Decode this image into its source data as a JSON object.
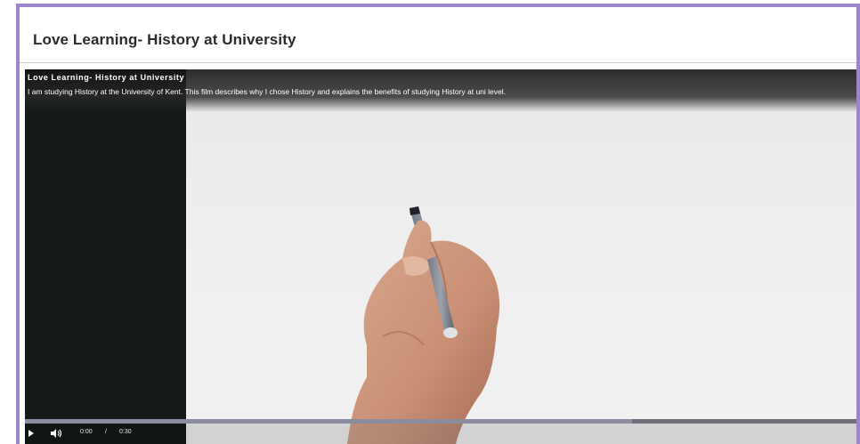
{
  "page": {
    "title": "Love Learning- History at University"
  },
  "video": {
    "title": "Love Learning- History at University",
    "description": "I am studying History at the University of Kent. This film describes why I chose History and explains the benefits of studying History at uni level.",
    "current_time": "0:00",
    "time_separator": "/",
    "duration": "0:30",
    "buffered_fraction": 0.73,
    "played_fraction": 0.0
  },
  "icons": {
    "play": "play-icon",
    "volume": "volume-icon"
  },
  "colors": {
    "frame_border": "#9b86c9",
    "video_left_pane": "#131a17"
  }
}
